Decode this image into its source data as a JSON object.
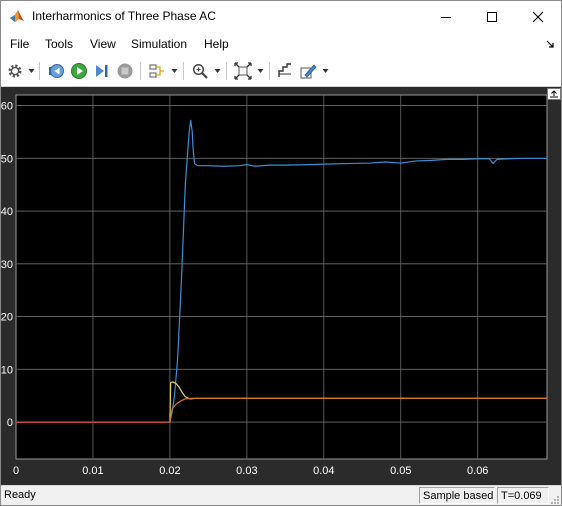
{
  "window": {
    "title": "Interharmonics of Three Phase AC",
    "icon": "matlab-icon",
    "controls": [
      "minimize-icon",
      "maximize-icon",
      "close-icon"
    ]
  },
  "menu": {
    "items": [
      "File",
      "Tools",
      "View",
      "Simulation",
      "Help"
    ]
  },
  "toolbar": {
    "buttons": [
      "gear-icon",
      "step-back-icon",
      "run-icon",
      "step-forward-icon",
      "stop-icon",
      "signal-select-icon",
      "zoom-icon",
      "autoscale-icon",
      "cursor-icon",
      "style-icon"
    ]
  },
  "status": {
    "state": "Ready",
    "mode": "Sample based",
    "time": "T=0.069"
  },
  "colors": {
    "plot_background": "#000000",
    "figure_background": "#2b2b2b",
    "grid": "#6e6e6e",
    "series_blue": "#3c8fd6",
    "series_yellow": "#e8d060",
    "series_orange": "#d8742c",
    "series_red": "#e84a3c"
  },
  "chart_data": {
    "type": "line",
    "title": "",
    "xlabel": "",
    "ylabel": "",
    "xlim": [
      0,
      0.069
    ],
    "ylim": [
      -7,
      62
    ],
    "xticks": [
      0,
      0.01,
      0.02,
      0.03,
      0.04,
      0.05,
      0.06
    ],
    "xtick_labels": [
      "0",
      "0.01",
      "0.02",
      "0.03",
      "0.04",
      "0.05",
      "0.06"
    ],
    "yticks": [
      0,
      10,
      20,
      30,
      40,
      50,
      60
    ],
    "ytick_labels": [
      "0",
      "10",
      "20",
      "30",
      "40",
      "50",
      "60"
    ],
    "grid": true,
    "series": [
      {
        "color": "#3c8fd6",
        "x": [
          0,
          0.02,
          0.0203,
          0.0206,
          0.021,
          0.0215,
          0.022,
          0.0225,
          0.0227,
          0.0229,
          0.023,
          0.0232,
          0.0236,
          0.024,
          0.025,
          0.027,
          0.029,
          0.03,
          0.031,
          0.033,
          0.035,
          0.038,
          0.04,
          0.043,
          0.046,
          0.048,
          0.05,
          0.052,
          0.054,
          0.056,
          0.058,
          0.06,
          0.0615,
          0.062,
          0.0625,
          0.064,
          0.066,
          0.069
        ],
        "y": [
          0,
          0,
          2,
          5,
          12,
          27,
          45,
          55,
          57.2,
          55,
          52,
          49,
          48.6,
          48.6,
          48.6,
          48.5,
          48.6,
          48.8,
          48.5,
          48.7,
          48.7,
          48.8,
          48.9,
          49.0,
          49.1,
          49.3,
          49.1,
          49.5,
          49.6,
          49.8,
          49.8,
          49.9,
          49.9,
          49.0,
          49.8,
          49.9,
          50.0,
          50.0
        ]
      },
      {
        "color": "#e8d060",
        "x": [
          0,
          0.02,
          0.0201,
          0.0204,
          0.0208,
          0.0212,
          0.0216,
          0.022,
          0.0226,
          0.0235,
          0.069
        ],
        "y": [
          0,
          0,
          7.5,
          7.6,
          7.3,
          6.6,
          5.6,
          4.8,
          4.4,
          4.5,
          4.5
        ]
      },
      {
        "color": "#d8742c",
        "x": [
          0,
          0.02,
          0.0203,
          0.0208,
          0.0214,
          0.022,
          0.0228,
          0.069
        ],
        "y": [
          0,
          0,
          2.5,
          3.4,
          4.0,
          4.4,
          4.5,
          4.5
        ]
      },
      {
        "color": "#e84a3c",
        "x": [
          0,
          0.02
        ],
        "y": [
          0,
          0
        ]
      }
    ]
  }
}
